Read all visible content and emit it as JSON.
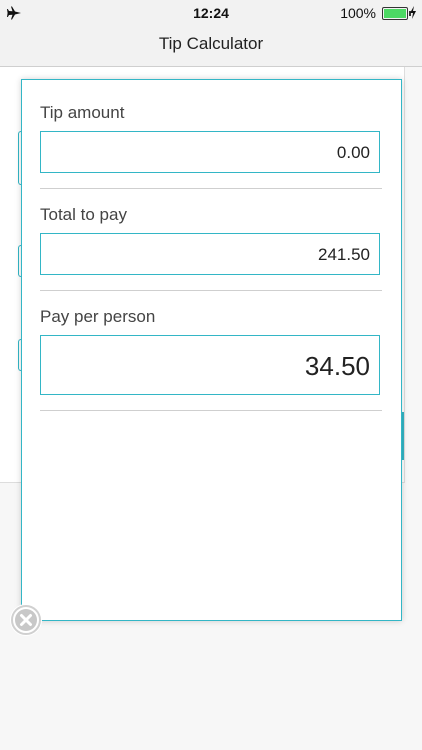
{
  "status_bar": {
    "time": "12:24",
    "battery_percent": "100%",
    "airplane_icon": "airplane-icon",
    "battery_icon": "battery-icon"
  },
  "nav_bar": {
    "title": "Tip Calculator"
  },
  "modal": {
    "tip_amount": {
      "label": "Tip amount",
      "value": "0.00"
    },
    "total_to_pay": {
      "label": "Total to pay",
      "value": "241.50"
    },
    "pay_per_person": {
      "label": "Pay per person",
      "value": "34.50"
    }
  },
  "close_icon": "close-icon",
  "colors": {
    "accent": "#33b6c6",
    "battery": "#4cd964"
  }
}
